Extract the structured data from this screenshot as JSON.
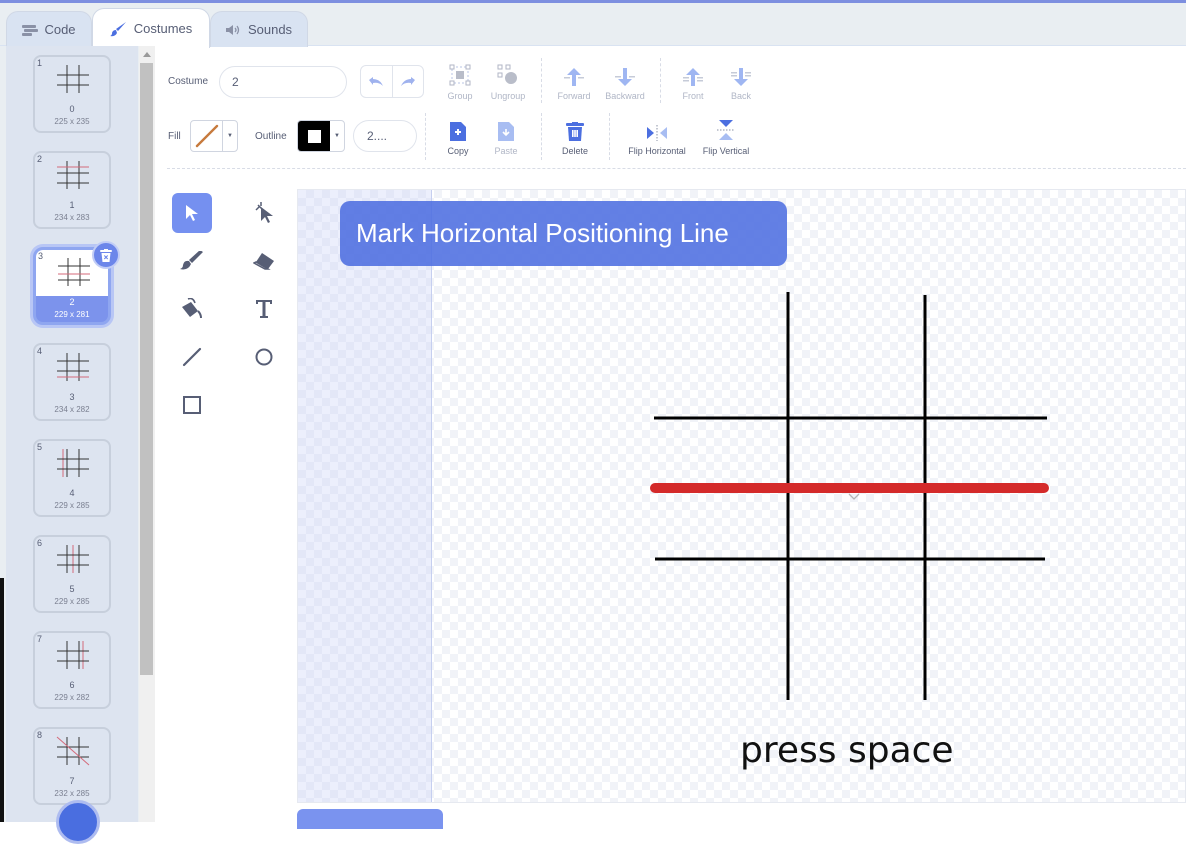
{
  "tabs": [
    {
      "label": "Code",
      "icon": "code-icon",
      "active": false
    },
    {
      "label": "Costumes",
      "icon": "brush-icon",
      "active": true
    },
    {
      "label": "Sounds",
      "icon": "speaker-icon",
      "active": false
    }
  ],
  "costumes": [
    {
      "index": "1",
      "name": "0",
      "size": "225 x 235",
      "selected": false
    },
    {
      "index": "2",
      "name": "1",
      "size": "234 x 283",
      "selected": false
    },
    {
      "index": "3",
      "name": "2",
      "size": "229 x 281",
      "selected": true
    },
    {
      "index": "4",
      "name": "3",
      "size": "234 x 282",
      "selected": false
    },
    {
      "index": "5",
      "name": "4",
      "size": "229 x 285",
      "selected": false
    },
    {
      "index": "6",
      "name": "5",
      "size": "229 x 285",
      "selected": false
    },
    {
      "index": "7",
      "name": "6",
      "size": "229 x 282",
      "selected": false
    },
    {
      "index": "8",
      "name": "7",
      "size": "232 x 285",
      "selected": false
    }
  ],
  "toolbar": {
    "costume_label": "Costume",
    "costume_name": "2",
    "fill_label": "Fill",
    "outline_label": "Outline",
    "outline_width": "2....",
    "fill_color": "#c77a3d",
    "outline_color": "#000000",
    "group": "Group",
    "ungroup": "Ungroup",
    "forward": "Forward",
    "backward": "Backward",
    "front": "Front",
    "back": "Back",
    "copy": "Copy",
    "paste": "Paste",
    "delete": "Delete",
    "flip_horizontal": "Flip Horizontal",
    "flip_vertical": "Flip Vertical"
  },
  "tools": [
    "select",
    "reshape",
    "brush",
    "eraser",
    "fill",
    "text",
    "line",
    "circle",
    "rectangle"
  ],
  "canvas": {
    "banner_text": "Mark Horizontal Positioning Line",
    "caption": "press space",
    "highlight_color": "#d42a2a",
    "accent_color": "#4d6ee0"
  }
}
